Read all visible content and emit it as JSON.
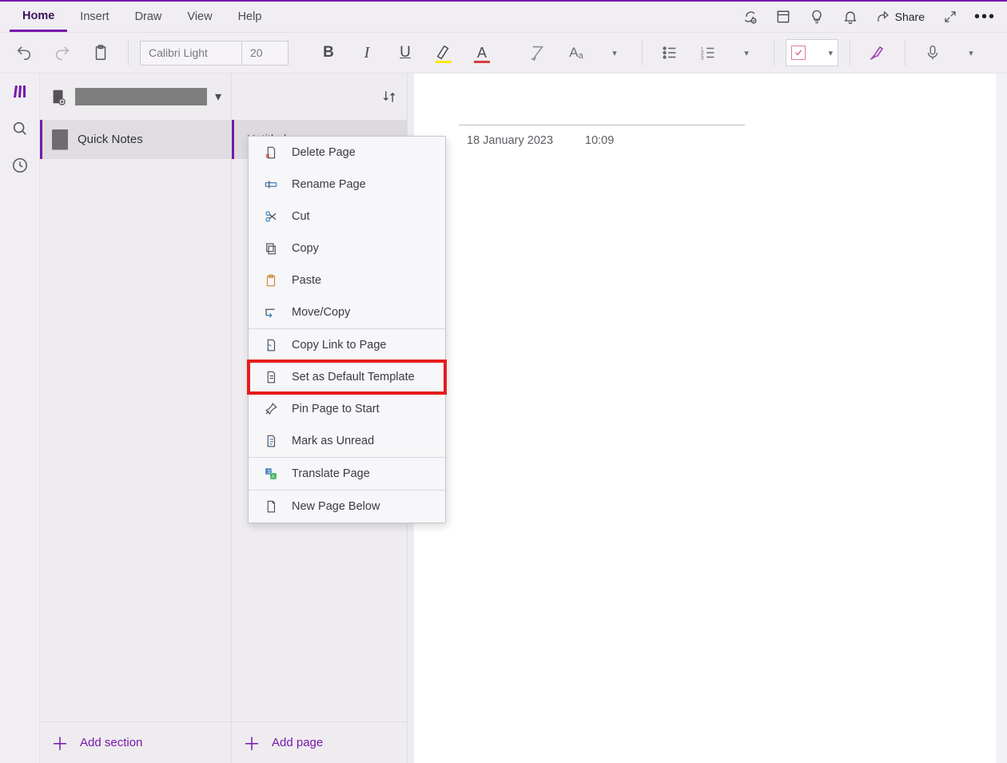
{
  "accent_color": "#7719aa",
  "tabs": [
    "Home",
    "Insert",
    "Draw",
    "View",
    "Help"
  ],
  "active_tab_index": 0,
  "header_right": {
    "share_label": "Share"
  },
  "ribbon": {
    "font_name": "Calibri Light",
    "font_size": "20"
  },
  "sections": {
    "items": [
      "Quick Notes"
    ],
    "add_label": "Add section"
  },
  "pages": {
    "items": [
      "Untitled page"
    ],
    "add_label": "Add page"
  },
  "canvas": {
    "date": "18 January 2023",
    "time": "10:09"
  },
  "context_menu": {
    "items": [
      {
        "label": "Delete Page",
        "icon": "page-x"
      },
      {
        "label": "Rename Page",
        "icon": "rename"
      },
      {
        "label": "Cut",
        "icon": "scissors"
      },
      {
        "label": "Copy",
        "icon": "copy"
      },
      {
        "label": "Paste",
        "icon": "paste"
      },
      {
        "label": "Move/Copy",
        "icon": "move"
      },
      {
        "label": "Copy Link to Page",
        "icon": "link-page",
        "sep_before": true
      },
      {
        "label": "Set as Default Template",
        "icon": "page",
        "highlight": true
      },
      {
        "label": "Pin Page to Start",
        "icon": "pin"
      },
      {
        "label": "Mark as Unread",
        "icon": "page-lines"
      },
      {
        "label": "Translate Page",
        "icon": "translate",
        "sep_before": true
      },
      {
        "label": "New Page Below",
        "icon": "page",
        "sep_before": true
      }
    ]
  }
}
